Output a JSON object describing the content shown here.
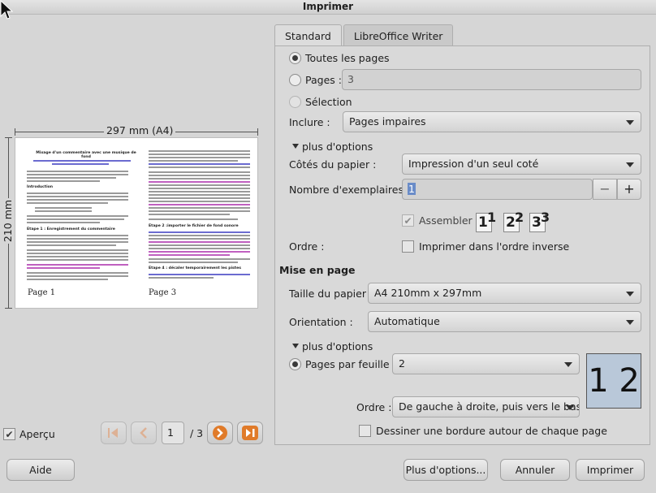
{
  "window": {
    "title": "Imprimer"
  },
  "tabs": [
    {
      "label": "Standard",
      "active": true
    },
    {
      "label": "LibreOffice Writer",
      "active": false
    }
  ],
  "range": {
    "all_pages": "Toutes les pages",
    "pages_label": "Pages :",
    "pages_value": "3",
    "selection": "Sélection",
    "include_label": "Inclure :",
    "include_value": "Pages impaires"
  },
  "more_options_1": "plus d'options",
  "paper_sides": {
    "label": "Côtés du papier :",
    "value": "Impression d'un seul coté"
  },
  "copies": {
    "label": "Nombre d'exemplaires :",
    "value": "1",
    "minus": "−",
    "plus": "+"
  },
  "collate": {
    "label": "Assembler",
    "icon_digits": [
      "1",
      "1",
      "2",
      "2",
      "3",
      "3"
    ]
  },
  "order": {
    "label": "Ordre :",
    "reverse_label": "Imprimer dans l'ordre inverse"
  },
  "layout": {
    "heading": "Mise en page",
    "paper_size_label": "Taille du papier :",
    "paper_size_value": "A4 210mm x 297mm",
    "orientation_label": "Orientation :",
    "orientation_value": "Automatique",
    "more_options_2": "plus d'options",
    "pages_per_sheet_label": "Pages par feuille :",
    "pages_per_sheet_value": "2",
    "order_label": "Ordre :",
    "order_value": "De gauche à droite, puis vers le bas",
    "border_label": "Dessiner une bordure autour de chaque page",
    "nup_preview": "1 2"
  },
  "preview": {
    "width_label": "297 mm (A4)",
    "height_label": "210 mm",
    "page_left_label": "Page 1",
    "page_right_label": "Page 3",
    "doc_title": "Mixage d'un commentaire avec une musique de fond",
    "section_intro": "Introduction",
    "section_step1": "Etape 1 : Enregistrement du commentaire",
    "section_step2": "Etape 2 :importer le fichier de fond sonore",
    "section_step4": "Etape 4 : décaler temporairement les pistes",
    "checkbox_label": "Aperçu",
    "current_page": "1",
    "total_pages": "/ 3"
  },
  "buttons": {
    "help": "Aide",
    "more_options": "Plus d'options...",
    "cancel": "Annuler",
    "print": "Imprimer"
  }
}
